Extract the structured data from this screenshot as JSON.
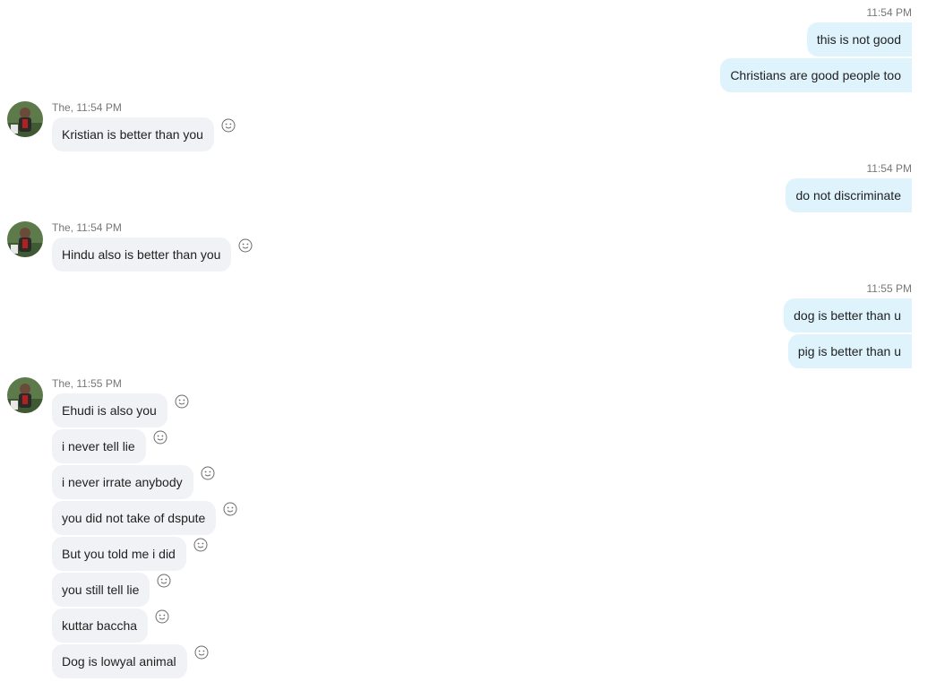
{
  "conversation": {
    "groups": [
      {
        "direction": "out",
        "time": "11:54 PM",
        "messages": [
          "this is not good",
          "Christians are good people too"
        ]
      },
      {
        "direction": "in",
        "meta": "The, 11:54 PM",
        "messages": [
          "Kristian is better than you"
        ]
      },
      {
        "direction": "out",
        "time": "11:54 PM",
        "messages": [
          "do not discriminate"
        ]
      },
      {
        "direction": "in",
        "meta": "The, 11:54 PM",
        "messages": [
          "Hindu also is better than you"
        ]
      },
      {
        "direction": "out",
        "time": "11:55 PM",
        "messages": [
          "dog is better than u",
          "pig is better than u"
        ]
      },
      {
        "direction": "in",
        "meta": "The, 11:55 PM",
        "messages": [
          "Ehudi is also you",
          "i never tell lie",
          "i never irrate anybody",
          "you did not take of dspute",
          "But you told me i did",
          "you still tell lie",
          "kuttar baccha",
          "Dog is lowyal animal"
        ]
      }
    ]
  },
  "icons": {
    "reaction": "smiley-reaction-icon",
    "avatar": "contact-avatar"
  },
  "colors": {
    "outgoing_bubble": "#dff3fd",
    "incoming_bubble": "#f0f2f5",
    "timestamp": "#777777"
  }
}
